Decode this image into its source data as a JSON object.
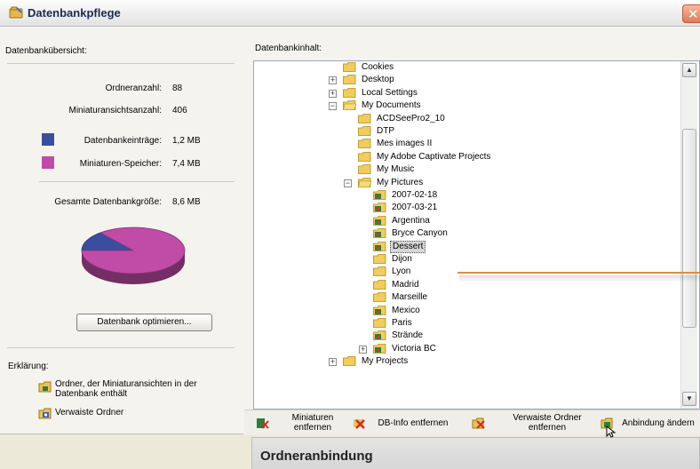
{
  "window": {
    "title": "Datenbankpflege",
    "close_glyph": "✕"
  },
  "overview": {
    "heading": "Datenbankübersicht:",
    "folder_count_label": "Ordneranzahl:",
    "folder_count_value": "88",
    "thumb_count_label": "Miniaturansichtsanzahl:",
    "thumb_count_value": "406",
    "db_entries_label": "Datenbankeinträge:",
    "db_entries_value": "1,2 MB",
    "db_entries_color": "#3a4ea0",
    "thumb_storage_label": "Miniaturen-Speicher:",
    "thumb_storage_value": "7,4 MB",
    "thumb_storage_color": "#c04ca8",
    "total_label": "Gesamte Datenbankgröße:",
    "total_value": "8,6 MB",
    "optimize_button": "Datenbank optimieren..."
  },
  "chart_data": {
    "type": "pie",
    "slices": [
      {
        "label": "Datenbankeinträge",
        "value": 1.2,
        "color": "#3a4ea0"
      },
      {
        "label": "Miniaturen-Speicher",
        "value": 7.4,
        "color": "#c04ca8"
      }
    ]
  },
  "legend": {
    "heading": "Erklärung:",
    "item1": "Ordner, der Miniaturansichten in der Datenbank enthält",
    "item2": "Verwaiste Ordner"
  },
  "content": {
    "heading": "Datenbankinhalt:",
    "tree": [
      {
        "label": "Cookies",
        "icon": "folder-icon",
        "expander": ""
      },
      {
        "label": "Desktop",
        "icon": "folder-icon",
        "expander": "+"
      },
      {
        "label": "Local Settings",
        "icon": "folder-icon",
        "expander": "+"
      },
      {
        "label": "My Documents",
        "icon": "folder-open-icon",
        "expander": "−"
      },
      {
        "label": "ACDSeePro2_10",
        "icon": "folder-icon",
        "expander": ""
      },
      {
        "label": "DTP",
        "icon": "folder-icon",
        "expander": ""
      },
      {
        "label": "Mes images II",
        "icon": "folder-icon",
        "expander": ""
      },
      {
        "label": "My Adobe Captivate Projects",
        "icon": "folder-icon",
        "expander": ""
      },
      {
        "label": "My Music",
        "icon": "folder-icon",
        "expander": ""
      },
      {
        "label": "My Pictures",
        "icon": "folder-open-icon",
        "expander": "−"
      },
      {
        "label": "2007-02-18",
        "icon": "folder-db-icon",
        "expander": ""
      },
      {
        "label": "2007-03-21",
        "icon": "folder-db-icon",
        "expander": ""
      },
      {
        "label": "Argentina",
        "icon": "folder-db-icon",
        "expander": ""
      },
      {
        "label": "Bryce Canyon",
        "icon": "folder-db-icon",
        "expander": ""
      },
      {
        "label": "Dessert",
        "icon": "folder-db-icon",
        "expander": "",
        "selected": true
      },
      {
        "label": "Dijon",
        "icon": "folder-icon",
        "expander": ""
      },
      {
        "label": "Lyon",
        "icon": "folder-icon",
        "expander": ""
      },
      {
        "label": "Madrid",
        "icon": "folder-icon",
        "expander": ""
      },
      {
        "label": "Marseille",
        "icon": "folder-icon",
        "expander": ""
      },
      {
        "label": "Mexico",
        "icon": "folder-db-icon",
        "expander": ""
      },
      {
        "label": "Paris",
        "icon": "folder-icon",
        "expander": ""
      },
      {
        "label": "Strände",
        "icon": "folder-db-icon",
        "expander": ""
      },
      {
        "label": "Victoria BC",
        "icon": "folder-db-icon",
        "expander": "+"
      },
      {
        "label": "My Projects",
        "icon": "folder-icon",
        "expander": "+"
      }
    ]
  },
  "toolbar": {
    "remove_thumbs": "Miniaturen entfernen",
    "remove_dbinfo": "DB-Info entfernen",
    "remove_orphans": "Verwaiste Ordner entfernen",
    "change_binding": "Anbindung ändern"
  },
  "bottom": {
    "title": "Ordneranbindung"
  },
  "scrollbar": {
    "up_glyph": "▲",
    "down_glyph": "▼"
  }
}
